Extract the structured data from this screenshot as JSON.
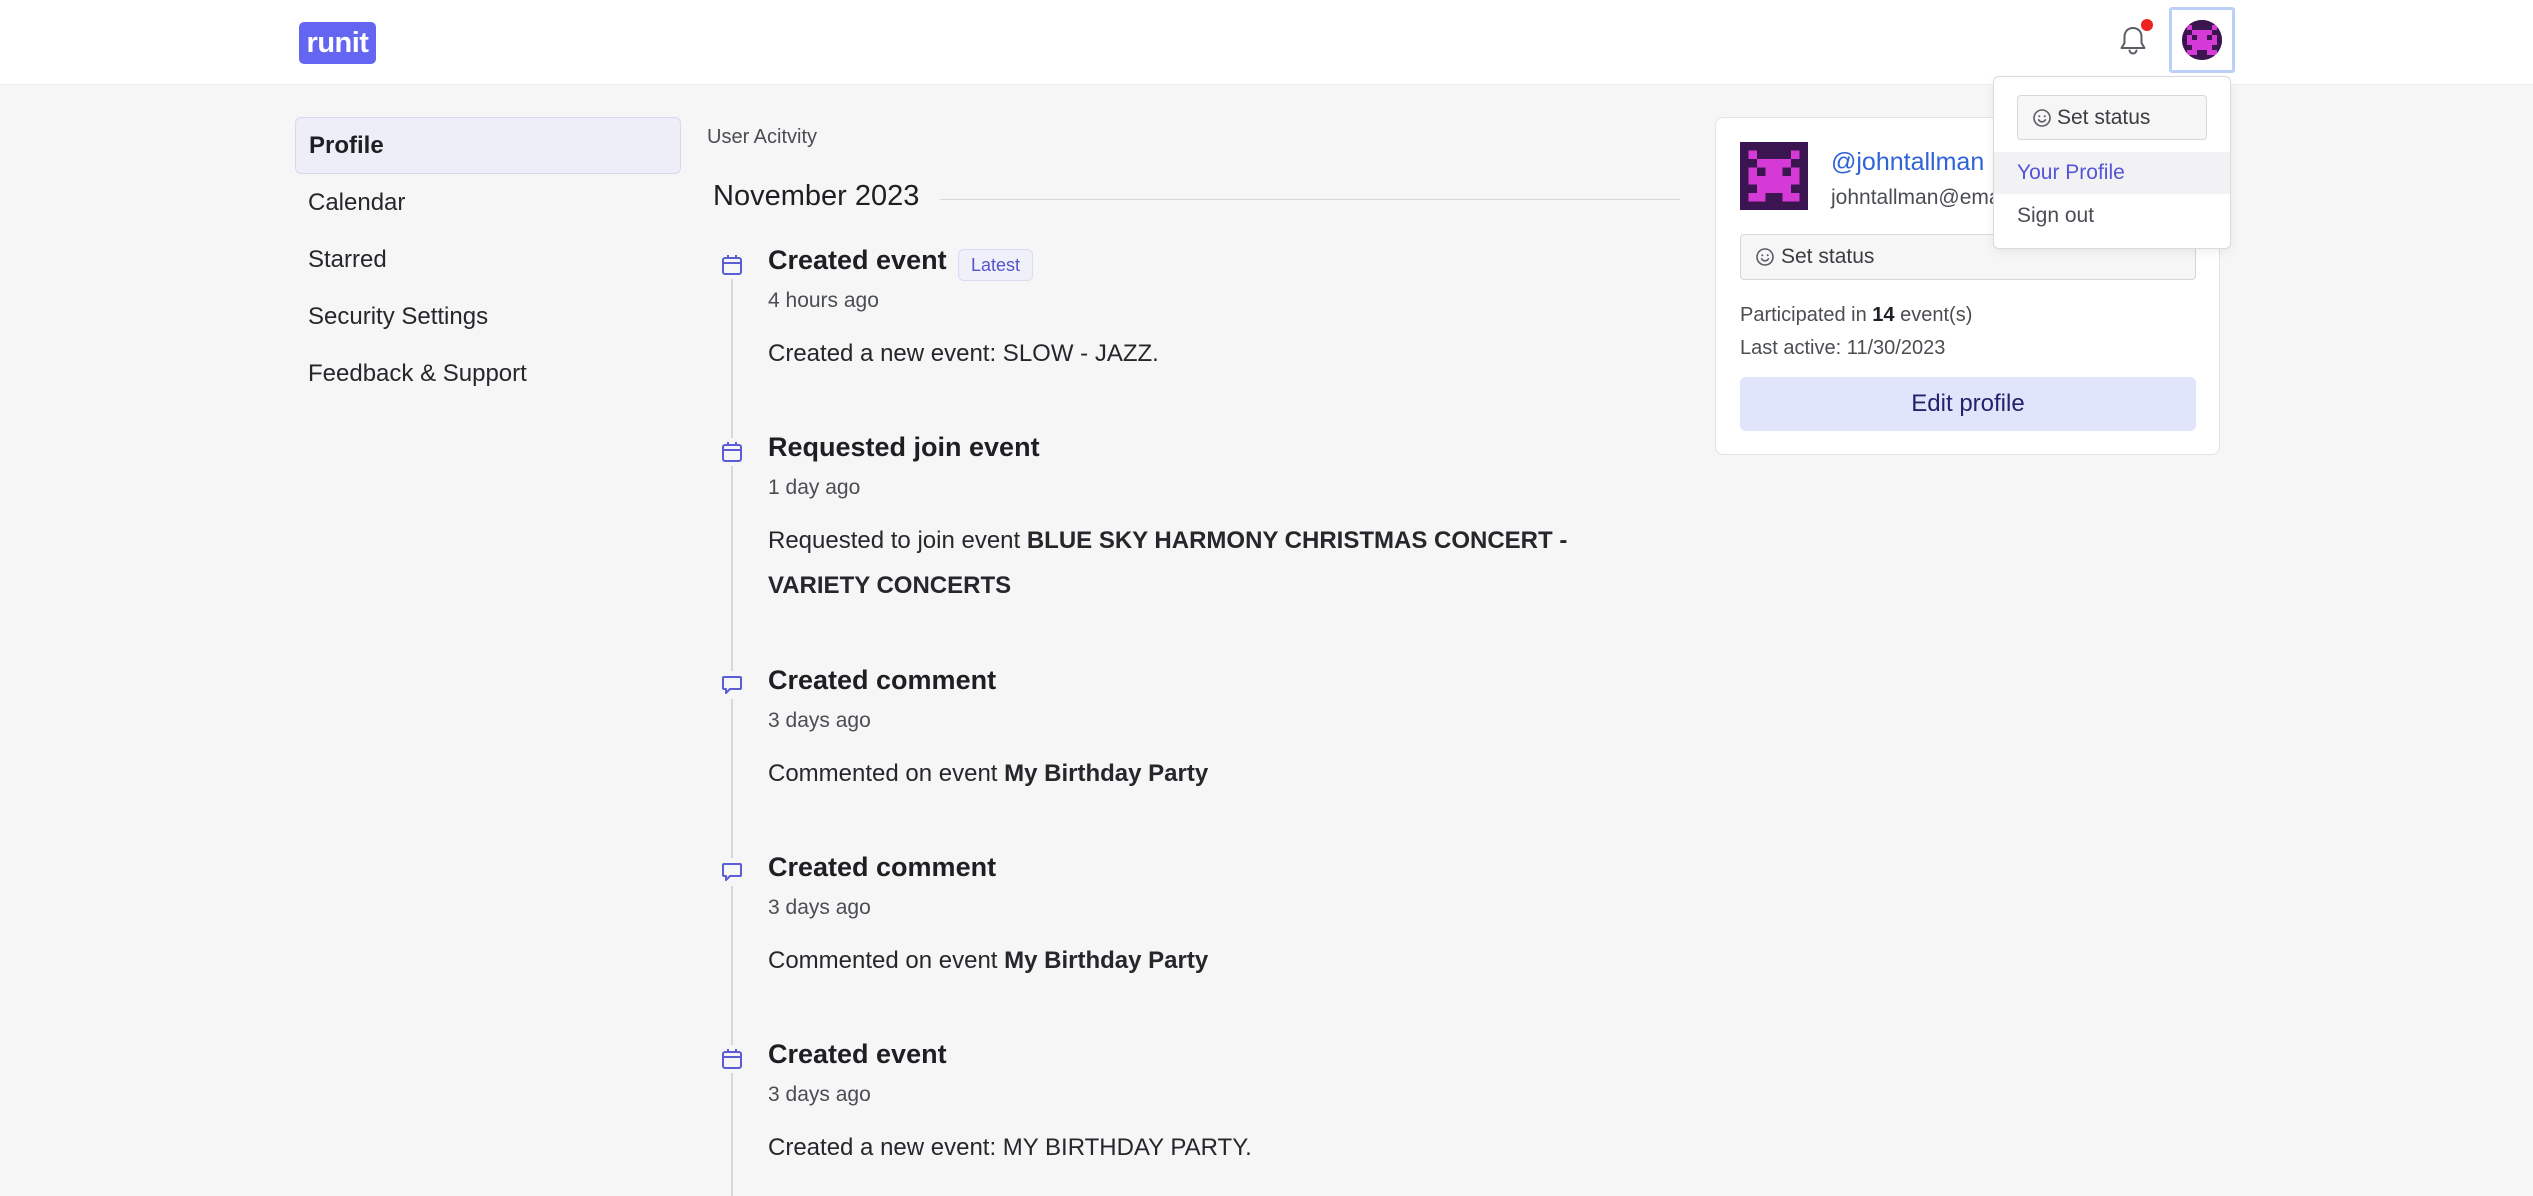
{
  "header": {
    "logo": "runit",
    "notification_indicator": true,
    "icons": [
      "bell-icon",
      "avatar-icon"
    ]
  },
  "sidebar": {
    "items": [
      {
        "label": "Profile",
        "active": true
      },
      {
        "label": "Calendar"
      },
      {
        "label": "Starred"
      },
      {
        "label": "Security Settings"
      },
      {
        "label": "Feedback & Support"
      }
    ]
  },
  "main": {
    "section_title": "User Acitvity",
    "month": "November 2023",
    "entries": [
      {
        "icon": "calendar-icon",
        "title": "Created event",
        "badge": "Latest",
        "time": "4 hours ago",
        "desc_prefix": "Created a new event: SLOW - JAZZ.",
        "desc_bold": ""
      },
      {
        "icon": "calendar-icon",
        "title": "Requested join event",
        "time": "1 day ago",
        "desc_prefix": "Requested to join event ",
        "desc_bold": "BLUE SKY HARMONY CHRISTMAS CONCERT - VARIETY CONCERTS"
      },
      {
        "icon": "comment-icon",
        "title": "Created comment",
        "time": "3 days ago",
        "desc_prefix": "Commented on event ",
        "desc_bold": "My Birthday Party"
      },
      {
        "icon": "comment-icon",
        "title": "Created comment",
        "time": "3 days ago",
        "desc_prefix": "Commented on event ",
        "desc_bold": "My Birthday Party"
      },
      {
        "icon": "calendar-icon",
        "title": "Created event",
        "time": "3 days ago",
        "desc_prefix": "Created a new event: MY BIRTHDAY PARTY.",
        "desc_bold": ""
      }
    ]
  },
  "profile_card": {
    "handle": "@johntallman",
    "email": "johntallman@ema",
    "set_status": "Set status",
    "participated_prefix": "Participated in ",
    "participated_count": "14",
    "participated_suffix": " event(s)",
    "last_active": "Last active: 11/30/2023",
    "edit_button": "Edit profile"
  },
  "dropdown": {
    "set_status": "Set status",
    "items": [
      {
        "label": "Your Profile",
        "active": true
      },
      {
        "label": "Sign out"
      }
    ]
  },
  "colors": {
    "accent": "#6466f1",
    "link": "#2f63d8",
    "notification": "#ef2020",
    "avatar_pink": "#d63ad6",
    "avatar_dark": "#3a1550"
  }
}
